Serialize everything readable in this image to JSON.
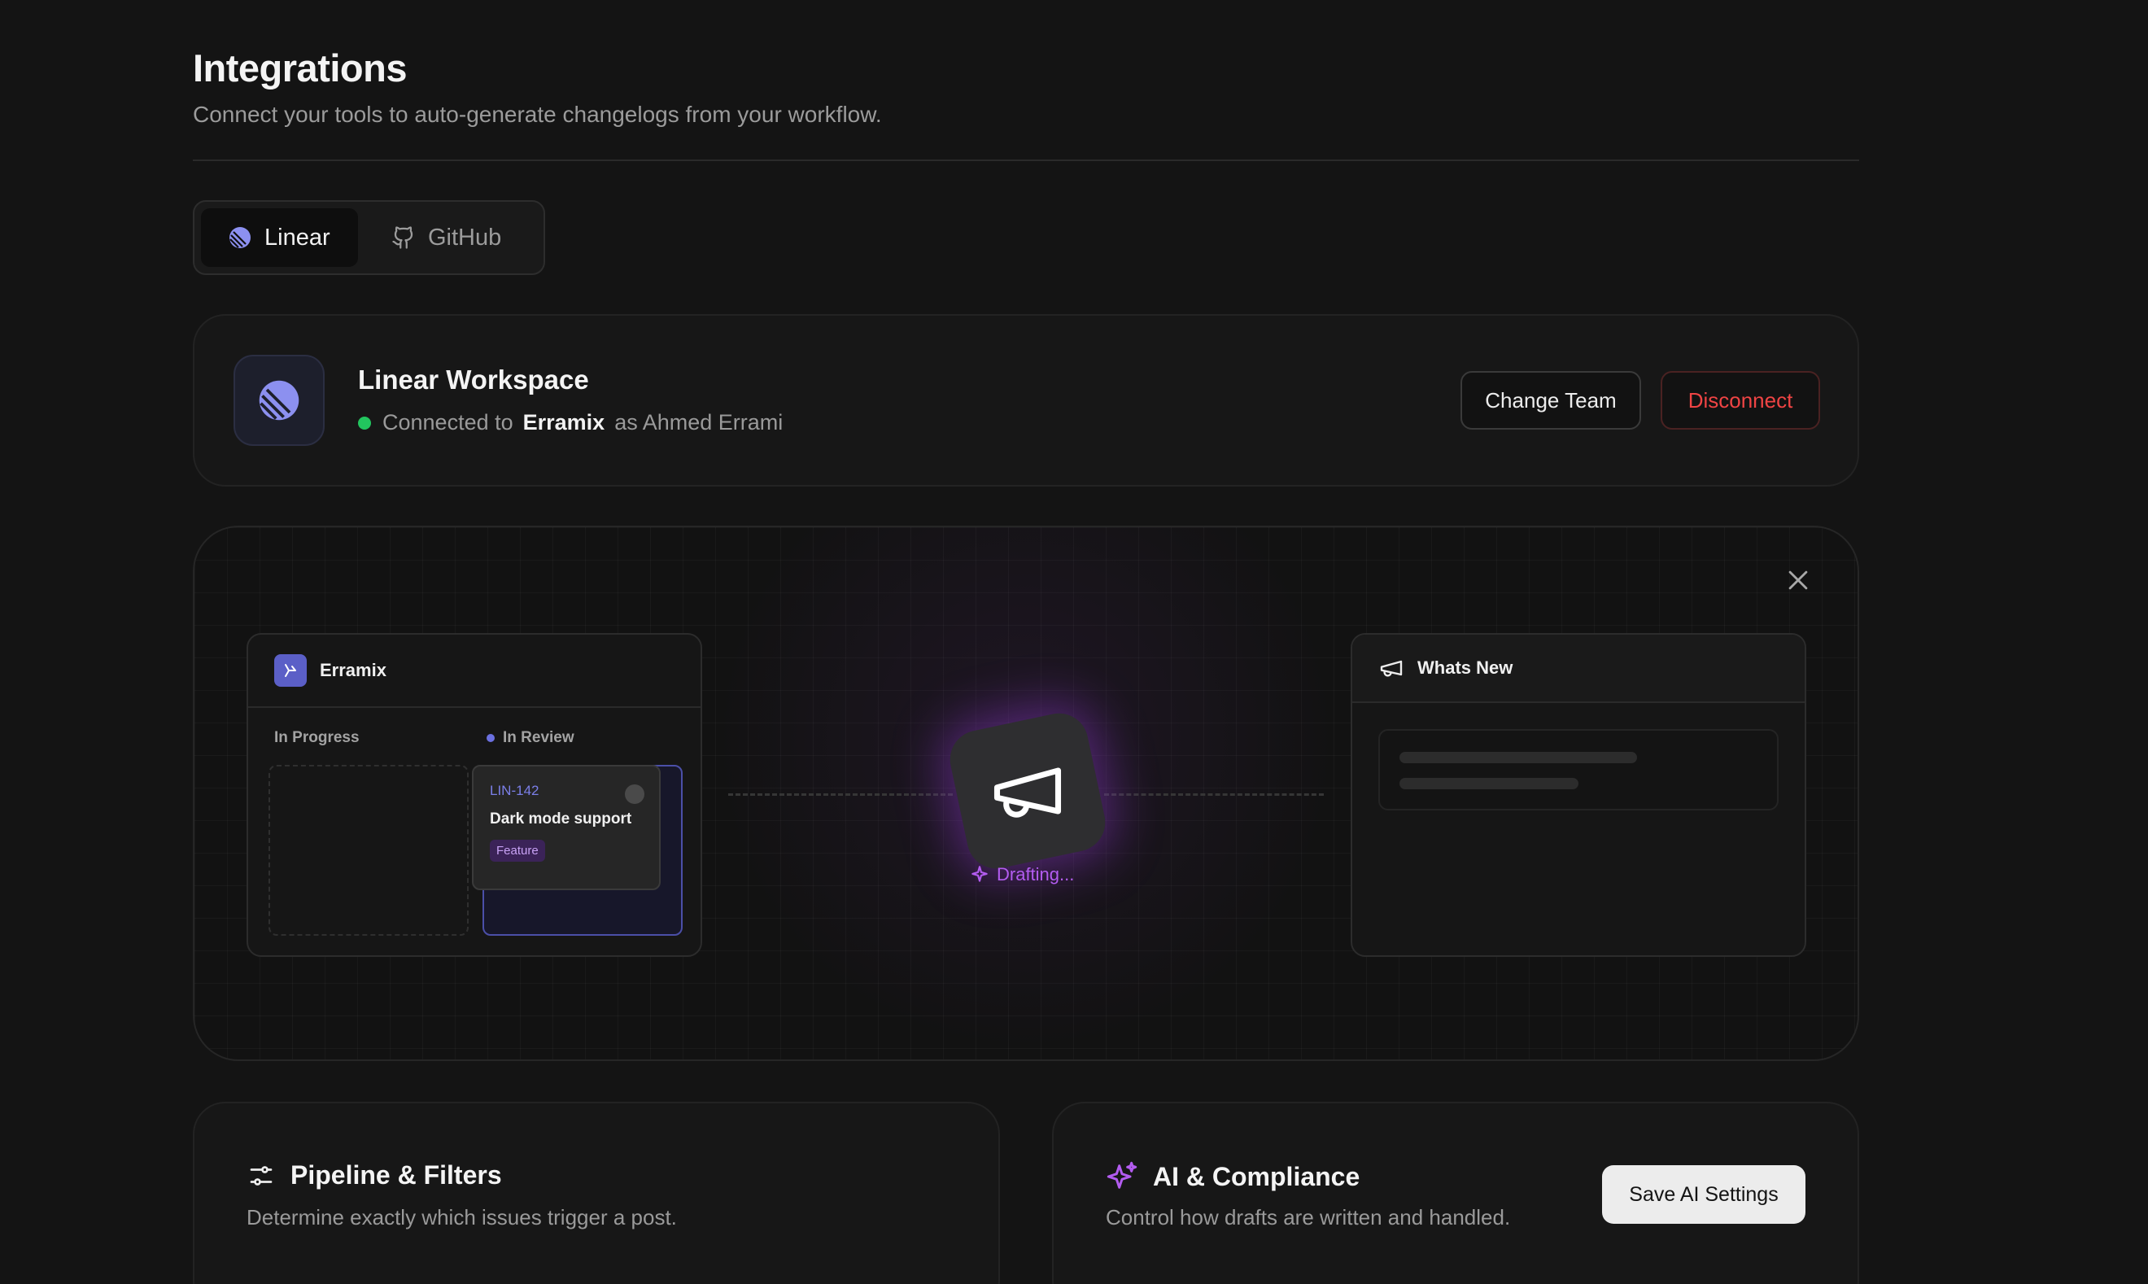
{
  "header": {
    "title": "Integrations",
    "subtitle": "Connect your tools to auto-generate changelogs from your workflow."
  },
  "tabs": [
    {
      "label": "Linear",
      "icon": "linear-icon",
      "active": true
    },
    {
      "label": "GitHub",
      "icon": "github-icon",
      "active": false
    }
  ],
  "workspace": {
    "title": "Linear Workspace",
    "status_prefix": "Connected to",
    "team": "Erramix",
    "user_text": "as Ahmed Errami",
    "status_color": "#22c55e",
    "change_label": "Change Team",
    "disconnect_label": "Disconnect"
  },
  "preview": {
    "board": {
      "name": "Erramix",
      "col_in_progress": "In Progress",
      "col_in_review": "In Review",
      "issue_id": "LIN-142",
      "issue_title": "Dark mode support",
      "issue_tag": "Feature"
    },
    "status_text": "Drafting...",
    "whats_new_title": "Whats New",
    "accent": "#b35cf0"
  },
  "pipeline": {
    "title": "Pipeline & Filters",
    "subtitle": "Determine exactly which issues trigger a post."
  },
  "ai": {
    "title": "AI & Compliance",
    "subtitle": "Control how drafts are written and handled.",
    "save_label": "Save AI Settings"
  }
}
